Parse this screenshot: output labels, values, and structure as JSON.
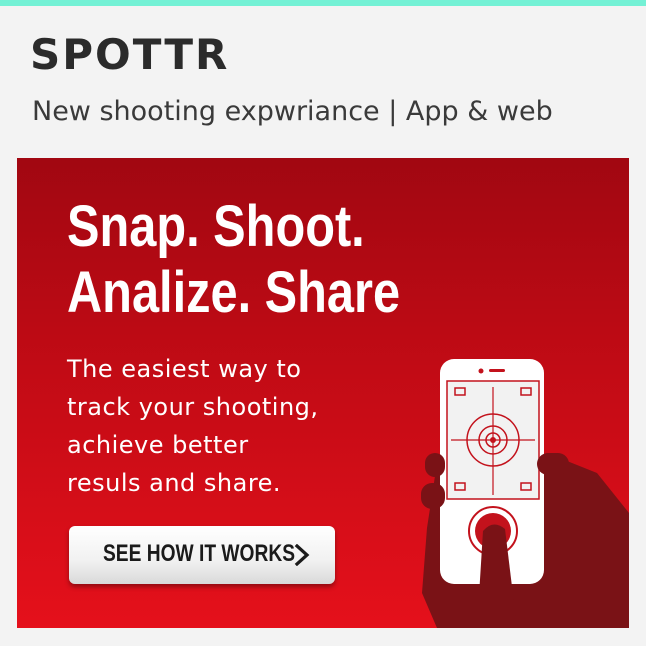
{
  "header": {
    "brand": "SPOTTR",
    "tagline": "New shooting expwriance | App & web"
  },
  "banner": {
    "headline_line1": "Snap. Shoot.",
    "headline_line2": "Analize. Share",
    "subtext_lines": [
      "The easiest way to",
      "track your shooting,",
      "achieve better",
      "resuls and share."
    ],
    "cta_label": "SEE HOW IT WORKS"
  },
  "icons": {
    "cta_arrow": "chevron-right-icon",
    "illustration": "phone-target-icon"
  },
  "colors": {
    "accent_bar": "#74f1d5",
    "banner_dark": "#a10711",
    "banner_light": "#e5101b",
    "hand": "#7a1216",
    "target": "#c3121c"
  }
}
